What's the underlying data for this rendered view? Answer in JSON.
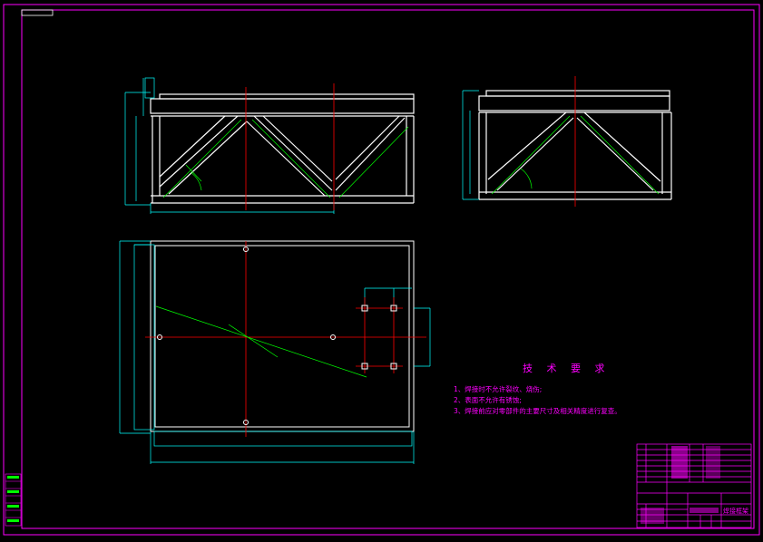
{
  "drawing": {
    "colors": {
      "background": "#000000",
      "frame": "#ff00ff",
      "outline": "#ffffff",
      "dimension": "#00ffff",
      "centerline": "#ff0000",
      "weld": "#00ff00",
      "text": "#ff00ff"
    }
  },
  "technical_requirements": {
    "title": "技 术 要 求",
    "items": [
      "1、焊接时不允许裂纹、烧伤;",
      "2、表面不允许有锈蚀;",
      "3、焊接前应对零部件的主要尺寸及相关精度进行复查。"
    ]
  },
  "title_block": {
    "drawing_name": "焊接框架"
  }
}
